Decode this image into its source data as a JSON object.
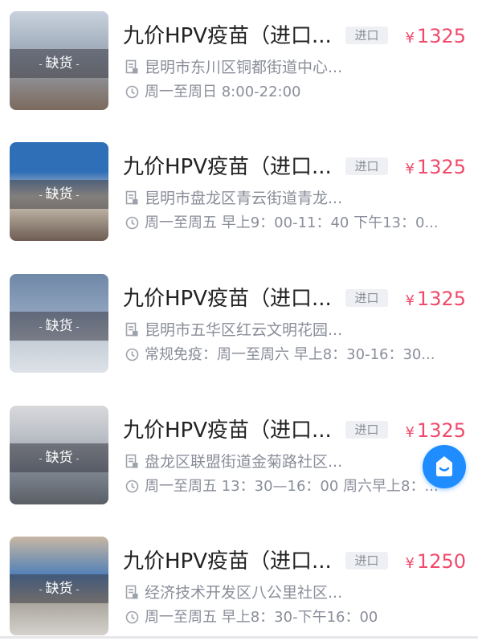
{
  "items": [
    {
      "title": "九价HPV疫苗（进口...",
      "tag": "进口",
      "price_symbol": "¥",
      "price": "1325",
      "stock_label": "缺货",
      "address": "昆明市东川区铜都街道中心...",
      "hours": "周一至周日 8:00-22:00",
      "photo_color": "#9aa6b5"
    },
    {
      "title": "九价HPV疫苗（进口...",
      "tag": "进口",
      "price_symbol": "¥",
      "price": "1325",
      "stock_label": "缺货",
      "address": "昆明市盘龙区青云街道青龙...",
      "hours": "周一至周五 早上9：00-11：40 下午13：0...",
      "photo_color": "#5b7fa8"
    },
    {
      "title": "九价HPV疫苗（进口...",
      "tag": "进口",
      "price_symbol": "¥",
      "price": "1325",
      "stock_label": "缺货",
      "address": "昆明市五华区红云文明花园...",
      "hours": "常规免疫：周一至周六 早上8：30-16：30...",
      "photo_color": "#8fa3bd"
    },
    {
      "title": "九价HPV疫苗（进口...",
      "tag": "进口",
      "price_symbol": "¥",
      "price": "1325",
      "stock_label": "缺货",
      "address": "盘龙区联盟街道金菊路社区...",
      "hours": "周一至周五 13：30—16：00 周六早上8：...",
      "photo_color": "#7f8792"
    },
    {
      "title": "九价HPV疫苗（进口...",
      "tag": "进口",
      "price_symbol": "¥",
      "price": "1250",
      "stock_label": "缺货",
      "address": "经济技术开发区八公里社区...",
      "hours": "周一至周五 早上8：30-下午16：00",
      "photo_color": "#a8a49c"
    }
  ],
  "floating_button": {
    "icon": "chat-bubble-icon",
    "color": "#1f8cff"
  }
}
